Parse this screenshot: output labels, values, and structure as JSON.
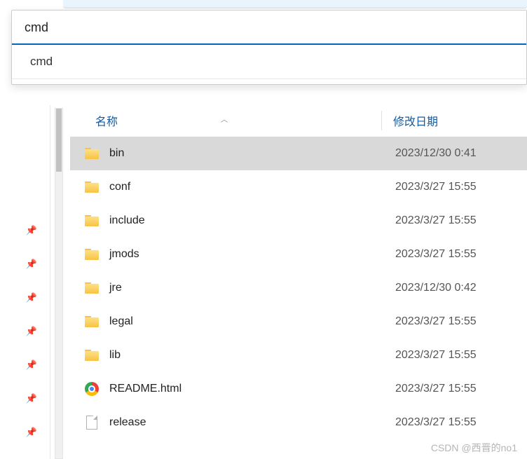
{
  "address": {
    "input_value": "cmd",
    "suggestions": [
      "cmd"
    ]
  },
  "columns": {
    "name": "名称",
    "modified": "修改日期"
  },
  "files": [
    {
      "name": "bin",
      "modified": "2023/12/30 0:41",
      "icon": "folder",
      "selected": true
    },
    {
      "name": "conf",
      "modified": "2023/3/27 15:55",
      "icon": "folder",
      "selected": false
    },
    {
      "name": "include",
      "modified": "2023/3/27 15:55",
      "icon": "folder",
      "selected": false
    },
    {
      "name": "jmods",
      "modified": "2023/3/27 15:55",
      "icon": "folder",
      "selected": false
    },
    {
      "name": "jre",
      "modified": "2023/12/30 0:42",
      "icon": "folder",
      "selected": false
    },
    {
      "name": "legal",
      "modified": "2023/3/27 15:55",
      "icon": "folder",
      "selected": false
    },
    {
      "name": "lib",
      "modified": "2023/3/27 15:55",
      "icon": "folder",
      "selected": false
    },
    {
      "name": "README.html",
      "modified": "2023/3/27 15:55",
      "icon": "chrome",
      "selected": false
    },
    {
      "name": "release",
      "modified": "2023/3/27 15:55",
      "icon": "document",
      "selected": false
    }
  ],
  "quick_access_pins": 7,
  "watermark": "CSDN @西晋的no1"
}
